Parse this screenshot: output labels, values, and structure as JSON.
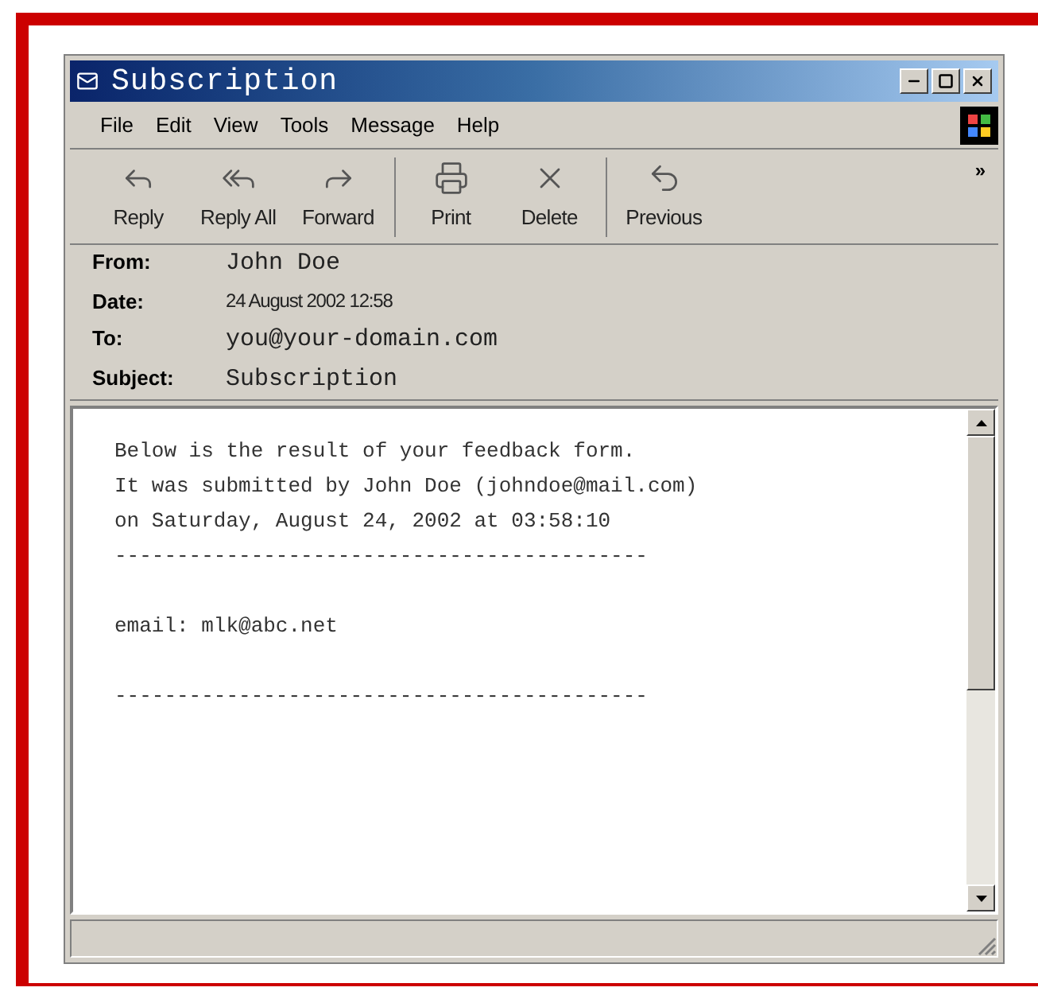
{
  "window": {
    "title": "Subscription",
    "buttons": [
      {
        "kind": "minimize"
      },
      {
        "kind": "maximize"
      },
      {
        "kind": "close"
      }
    ]
  },
  "menu": [
    "File",
    "Edit",
    "View",
    "Tools",
    "Message",
    "Help"
  ],
  "toolbar": [
    {
      "kind": "reply",
      "label": "Reply"
    },
    {
      "kind": "reply_all",
      "label": "Reply All"
    },
    {
      "kind": "forward",
      "label": "Forward"
    },
    {
      "kind": "print",
      "label": "Print"
    },
    {
      "kind": "delete",
      "label": "Delete"
    },
    {
      "kind": "previous",
      "label": "Previous"
    }
  ],
  "toolbar_more": "»",
  "header": [
    {
      "label": "From:",
      "value": "John Doe",
      "kind": "mono"
    },
    {
      "label": "Date:",
      "value": "24 August 2002 12:58",
      "kind": "plain"
    },
    {
      "label": "To:",
      "value": "you@your-domain.com",
      "kind": "mono"
    },
    {
      "label": "Subject:",
      "value": "Subscription",
      "kind": "mono"
    }
  ],
  "body": [
    [
      "Below is the result of your feedback form.",
      "It was submitted by John Doe (johndoe@mail.com)",
      "on Saturday, August 24, 2002 at 03:58:10",
      "-------------------------------------------"
    ],
    [
      "email: mlk@abc.net"
    ],
    [
      "-------------------------------------------"
    ]
  ]
}
